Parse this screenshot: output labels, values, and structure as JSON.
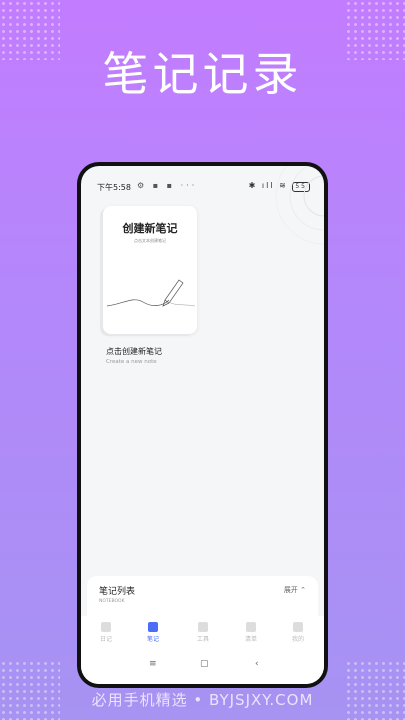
{
  "headline": "笔记记录",
  "footer": "必用手机精选 • BYJSJXY.COM",
  "status": {
    "time": "下午5:58",
    "left_icons": "⚙ ▪ ▪ ···",
    "right_icons": "✱ ıll ≋",
    "battery": "55"
  },
  "card": {
    "title": "创建新笔记",
    "subtitle": "点击文本创建笔记",
    "label": "点击创建新笔记",
    "sublabel": "Create a new note"
  },
  "sheet": {
    "title": "笔记列表",
    "subtitle": "NOTEBOOK",
    "expand": "展开 ⌃"
  },
  "tabs": [
    {
      "label": "日记",
      "icon": "diary-icon"
    },
    {
      "label": "笔记",
      "icon": "note-icon"
    },
    {
      "label": "工具",
      "icon": "toolbox-icon"
    },
    {
      "label": "清单",
      "icon": "checklist-icon"
    },
    {
      "label": "我的",
      "icon": "profile-icon"
    }
  ],
  "nav": {
    "menu": "≡",
    "home": "▢",
    "back": "‹"
  },
  "colors": {
    "accent": "#4a6cf7",
    "bg_top": "#c27cff",
    "bg_bottom": "#a693f2"
  }
}
